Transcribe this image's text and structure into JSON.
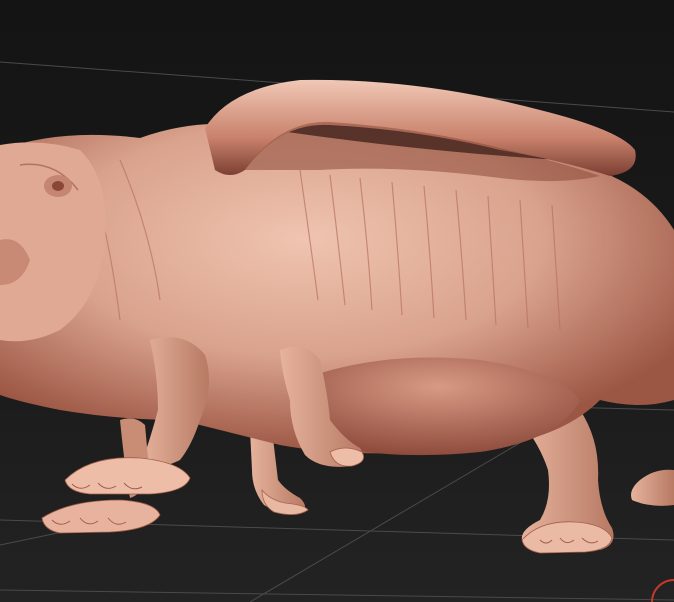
{
  "viewport": {
    "background_color": "#141414",
    "floor_grid_color": "#4a4a4a",
    "grid": true
  },
  "model": {
    "material_color": "#d9a28c",
    "shadow_color": "#7a3e32",
    "highlight_color": "#f5d0bf",
    "parts": [
      "head",
      "eye",
      "torso",
      "crest",
      "belly",
      "front-leg",
      "front-paw",
      "mid-leg",
      "mid-paw",
      "hind-legs",
      "hind-paw",
      "far-paw"
    ]
  },
  "gizmo": {
    "icon": "axis-gizmo-icon",
    "color": "#c23a2c"
  }
}
